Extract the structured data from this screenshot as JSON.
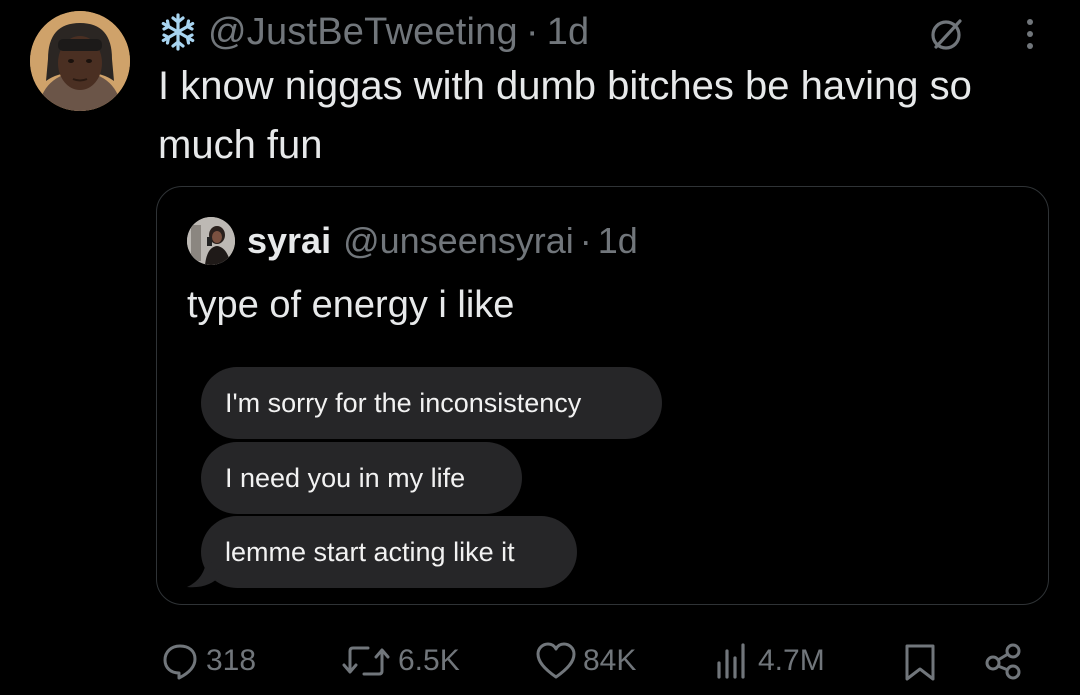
{
  "author": {
    "badge_icon": "snowflake-icon",
    "handle": "@JustBeTweeting",
    "separator": "·",
    "time": "1d",
    "avatar_icon": "avatar"
  },
  "tweet": {
    "text": "I know niggas with dumb bitches be having so much fun"
  },
  "header_icons": [
    "grok-icon",
    "more-icon"
  ],
  "quote": {
    "name": "syrai",
    "handle": "@unseensyrai",
    "separator": "·",
    "time": "1d",
    "text": "type of energy i like",
    "messages": [
      "I'm sorry for the inconsistency",
      "I need you in my life",
      "lemme start acting like it"
    ]
  },
  "actions": {
    "replies": "318",
    "retweets": "6.5K",
    "likes": "84K",
    "views": "4.7M"
  },
  "colors": {
    "background": "#000000",
    "text": "#e7e9ea",
    "muted": "#71767b",
    "bubble": "#262628",
    "border": "#2f3336",
    "snowflake": "#a8d4f0"
  }
}
